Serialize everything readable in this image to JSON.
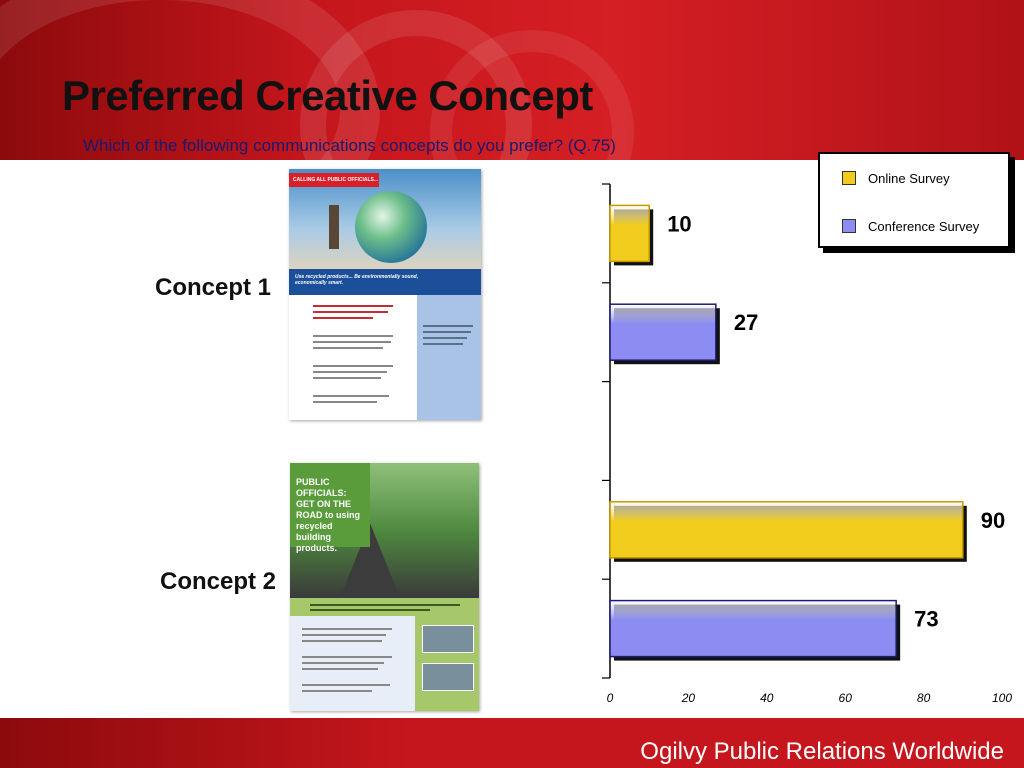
{
  "slide": {
    "title": "Preferred Creative Concept",
    "subtitle": "Which of the following communications concepts do you prefer? (Q.75)",
    "footer": "Ogilvy Public Relations Worldwide"
  },
  "concepts": [
    {
      "label": "Concept 1",
      "poster": {
        "tag": "CALLING ALL PUBLIC OFFICIALS...",
        "headline": "Use recycled products... Be environmentally sound, economically smart."
      }
    },
    {
      "label": "Concept 2",
      "poster": {
        "headline": "PUBLIC OFFICIALS: GET ON THE ROAD to using recycled building products."
      }
    }
  ],
  "colors": {
    "online": "#f2cc1c",
    "online_edge": "#c99a00",
    "conference": "#8c8cf2",
    "conference_edge": "#1c1c70"
  },
  "chart_data": {
    "type": "bar",
    "orientation": "horizontal",
    "categories": [
      "Concept 1",
      "Concept 2"
    ],
    "series": [
      {
        "name": "Online Survey",
        "values": [
          10,
          90
        ]
      },
      {
        "name": "Conference Survey",
        "values": [
          27,
          73
        ]
      }
    ],
    "value_labels": [
      [
        "10",
        "90"
      ],
      [
        "27",
        "73"
      ]
    ],
    "xlim": [
      0,
      100
    ],
    "xticks": [
      0,
      20,
      40,
      60,
      80,
      100
    ],
    "xtick_labels": [
      "0",
      "20",
      "40",
      "60",
      "80",
      "100"
    ],
    "grid": false,
    "legend": "top-right"
  }
}
